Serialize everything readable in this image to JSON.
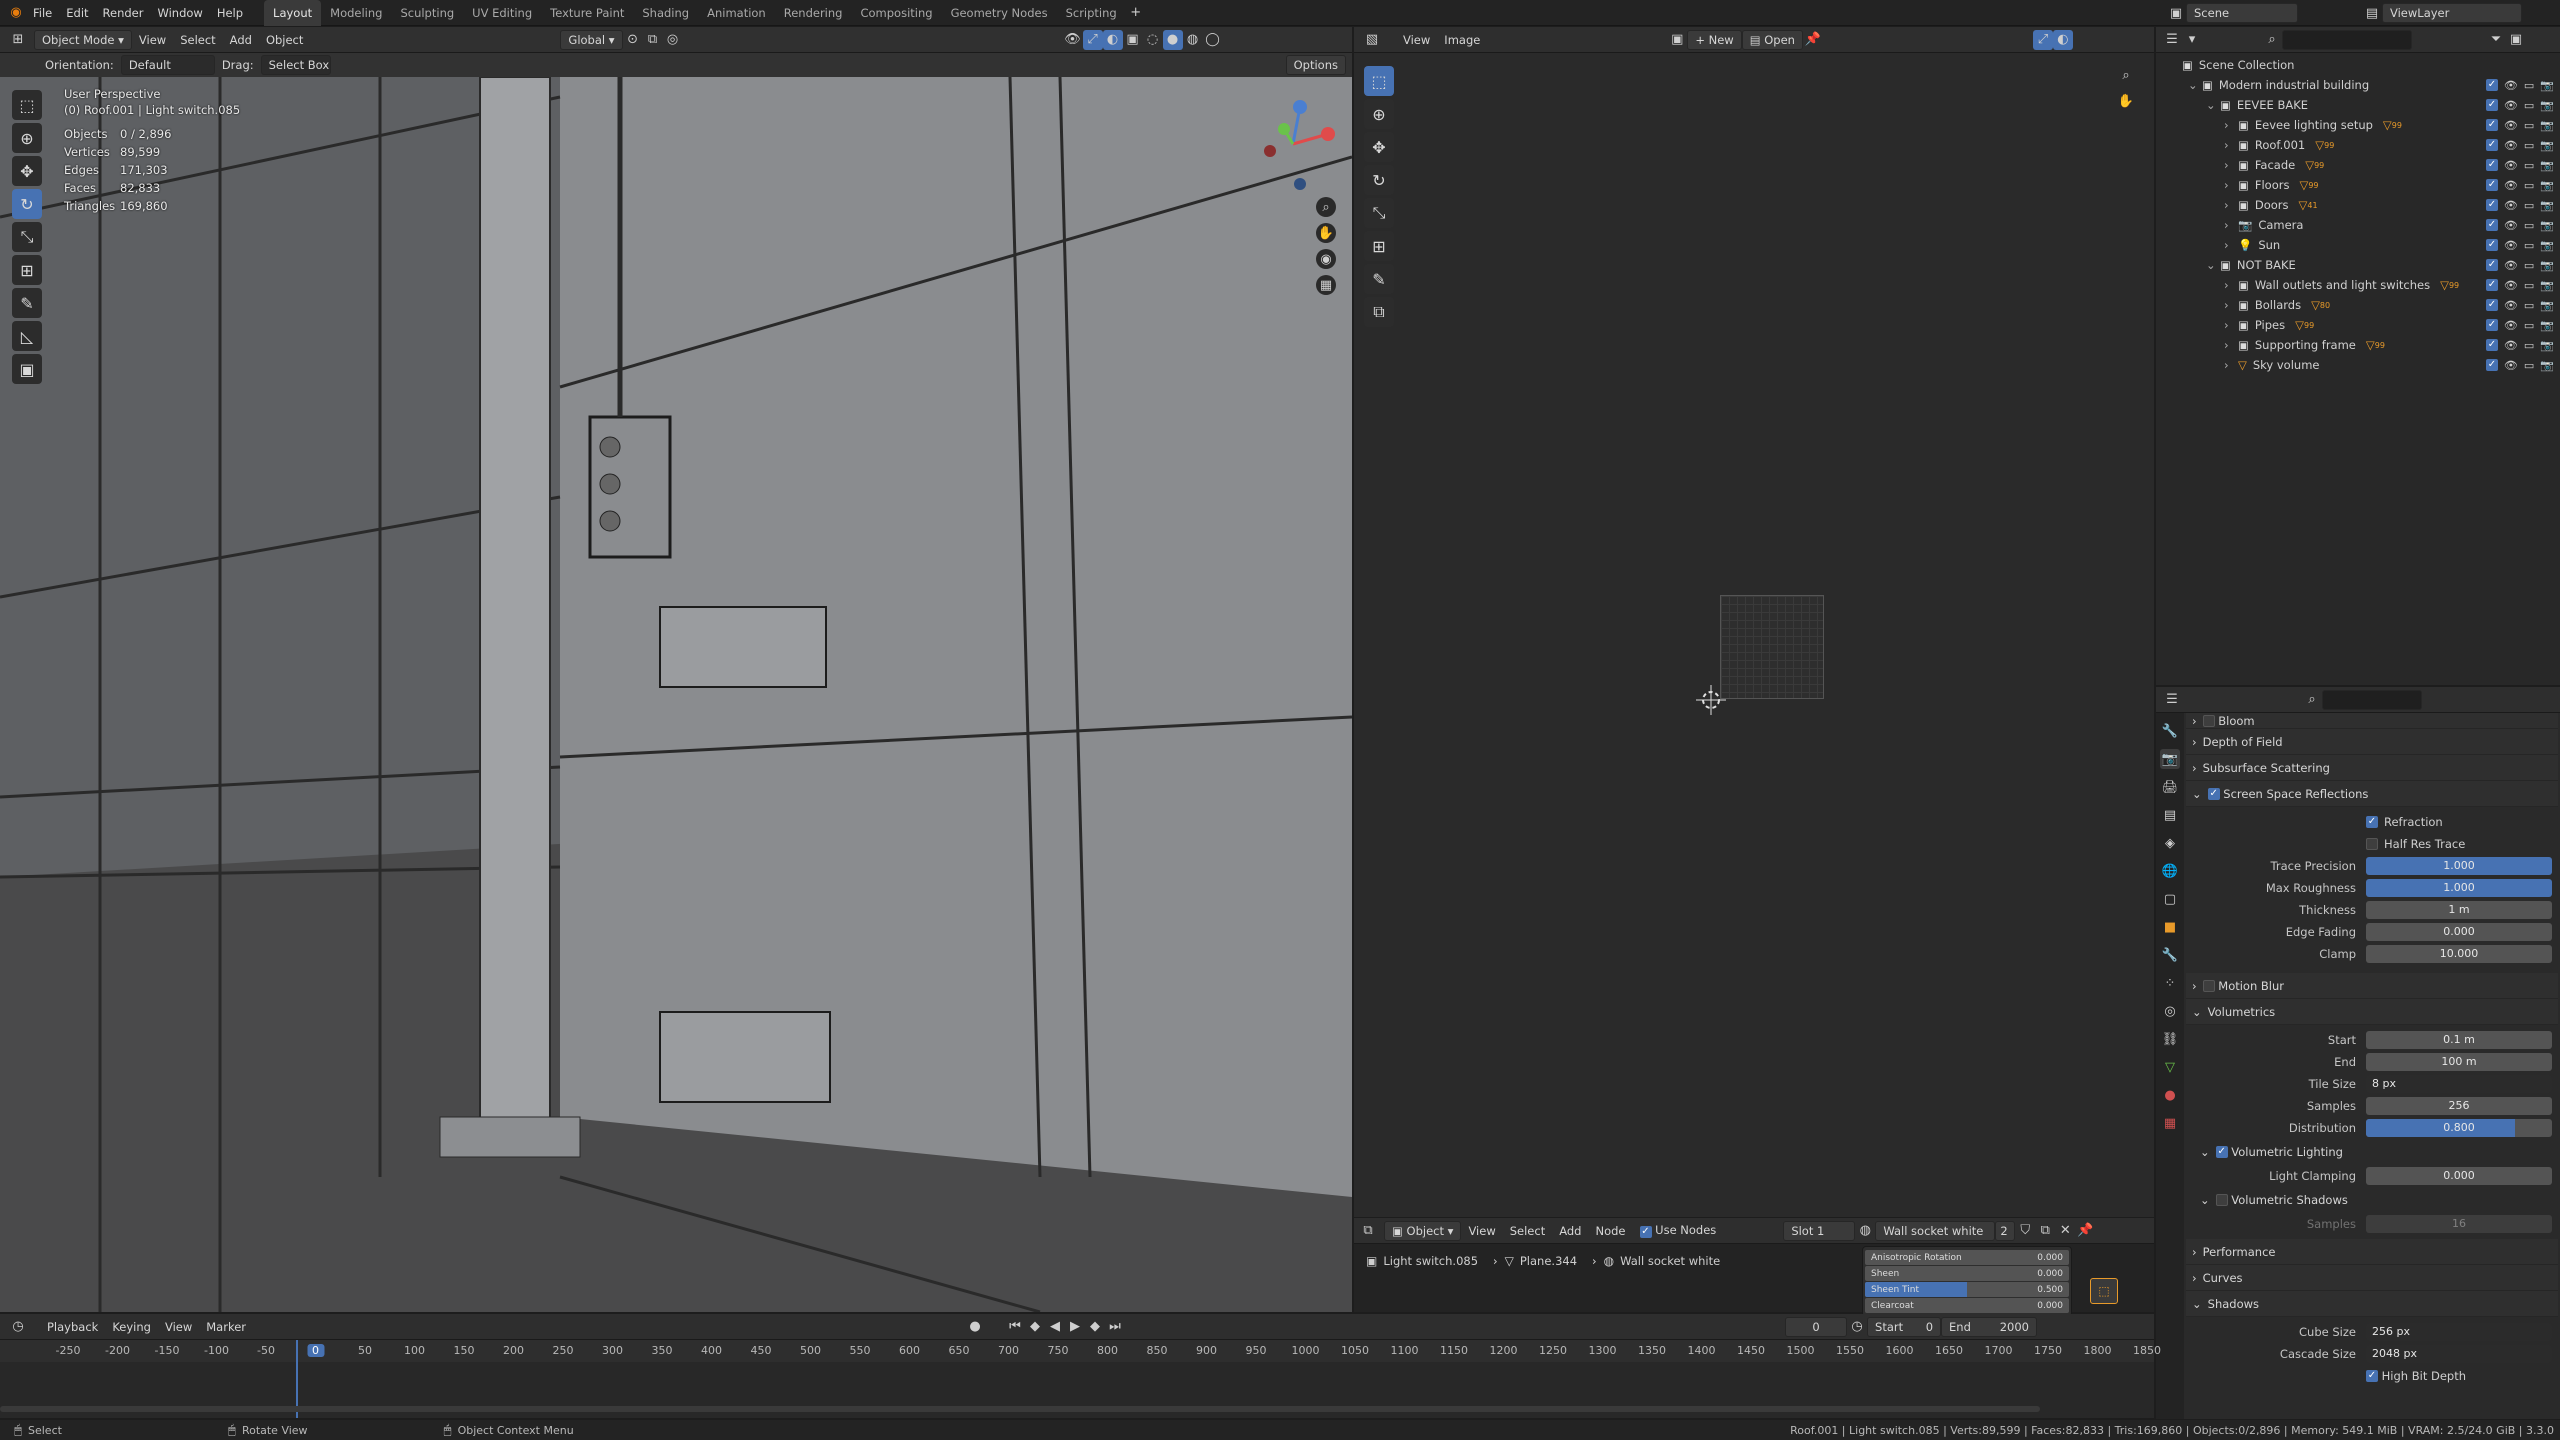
{
  "topbar": {
    "menus": [
      "File",
      "Edit",
      "Render",
      "Window",
      "Help"
    ],
    "workspaces": [
      "Layout",
      "Modeling",
      "Sculpting",
      "UV Editing",
      "Texture Paint",
      "Shading",
      "Animation",
      "Rendering",
      "Compositing",
      "Geometry Nodes",
      "Scripting"
    ],
    "active_workspace": "Layout",
    "scene_label": "Scene",
    "viewlayer_label": "ViewLayer"
  },
  "viewport": {
    "mode": "Object Mode",
    "menus": [
      "View",
      "Select",
      "Add",
      "Object"
    ],
    "transform": "Global",
    "orientation_label": "Orientation:",
    "orientation_value": "Default",
    "drag_label": "Drag:",
    "drag_value": "Select Box",
    "options_label": "Options",
    "perspective": "User Perspective",
    "active_object": "(0) Roof.001 | Light switch.085",
    "stats": [
      {
        "k": "Objects",
        "v": "0 / 2,896"
      },
      {
        "k": "Vertices",
        "v": "89,599"
      },
      {
        "k": "Edges",
        "v": "171,303"
      },
      {
        "k": "Faces",
        "v": "82,833"
      },
      {
        "k": "Triangles",
        "v": "169,860"
      }
    ]
  },
  "image_editor": {
    "menus": [
      "View",
      "Image"
    ],
    "new_label": "New",
    "open_label": "Open"
  },
  "node_editor": {
    "object_label": "Object",
    "menus": [
      "View",
      "Select",
      "Add",
      "Node"
    ],
    "use_nodes": "Use Nodes",
    "slot": "Slot 1",
    "material": "Wall socket white",
    "users": "2",
    "breadcrumb": [
      "Light switch.085",
      "Plane.344",
      "Wall socket white"
    ],
    "sliders": [
      {
        "label": "Anisotropic Rotation",
        "value": "0.000",
        "fill": 0
      },
      {
        "label": "Sheen",
        "value": "0.000",
        "fill": 0
      },
      {
        "label": "Sheen Tint",
        "value": "0.500",
        "fill": 0.5
      },
      {
        "label": "Clearcoat",
        "value": "0.000",
        "fill": 0
      }
    ]
  },
  "outliner": {
    "root": "Scene Collection",
    "items": [
      {
        "name": "Modern industrial building",
        "depth": 1,
        "icon": "collection"
      },
      {
        "name": "EEVEE BAKE",
        "depth": 2,
        "icon": "collection"
      },
      {
        "name": "Eevee lighting setup",
        "depth": 3,
        "icon": "collection",
        "badge": "99"
      },
      {
        "name": "Roof.001",
        "depth": 3,
        "icon": "collection",
        "badge": "99"
      },
      {
        "name": "Facade",
        "depth": 3,
        "icon": "collection",
        "badge": "99"
      },
      {
        "name": "Floors",
        "depth": 3,
        "icon": "collection",
        "badge": "99"
      },
      {
        "name": "Doors",
        "depth": 3,
        "icon": "collection",
        "badge": "41"
      },
      {
        "name": "Camera",
        "depth": 3,
        "icon": "camera"
      },
      {
        "name": "Sun",
        "depth": 3,
        "icon": "light"
      },
      {
        "name": "NOT BAKE",
        "depth": 2,
        "icon": "collection"
      },
      {
        "name": "Wall outlets and light switches",
        "depth": 3,
        "icon": "collection",
        "badge": "99"
      },
      {
        "name": "Bollards",
        "depth": 3,
        "icon": "collection",
        "badge": "80"
      },
      {
        "name": "Pipes",
        "depth": 3,
        "icon": "collection",
        "badge": "99"
      },
      {
        "name": "Supporting frame",
        "depth": 3,
        "icon": "collection",
        "badge": "99"
      },
      {
        "name": "Sky volume",
        "depth": 3,
        "icon": "mesh"
      }
    ]
  },
  "properties": {
    "sections": {
      "bloom": "Bloom",
      "dof": "Depth of Field",
      "sss": "Subsurface Scattering",
      "ssr": "Screen Space Reflections",
      "motion_blur": "Motion Blur",
      "volumetrics": "Volumetrics",
      "performance": "Performance",
      "curves": "Curves",
      "shadows": "Shadows"
    },
    "ssr_checks": [
      {
        "label": "Refraction",
        "on": true
      },
      {
        "label": "Half Res Trace",
        "on": false
      }
    ],
    "ssr_fields": [
      {
        "label": "Trace Precision",
        "value": "1.000",
        "blue": true
      },
      {
        "label": "Max Roughness",
        "value": "1.000",
        "blue": true
      },
      {
        "label": "Thickness",
        "value": "1 m",
        "blue": false
      },
      {
        "label": "Edge Fading",
        "value": "0.000",
        "blue": false
      },
      {
        "label": "Clamp",
        "value": "10.000",
        "blue": false
      }
    ],
    "vol_fields": [
      {
        "label": "Start",
        "value": "0.1 m"
      },
      {
        "label": "End",
        "value": "100 m"
      },
      {
        "label": "Tile Size",
        "value": "8 px"
      },
      {
        "label": "Samples",
        "value": "256"
      },
      {
        "label": "Distribution",
        "value": "0.800",
        "fill": 0.8
      }
    ],
    "vol_lighting": "Volumetric Lighting",
    "light_clamping_label": "Light Clamping",
    "light_clamping": "0.000",
    "vol_shadows": "Volumetric Shadows",
    "vol_shadow_samples_label": "Samples",
    "vol_shadow_samples": "16",
    "cube_size_label": "Cube Size",
    "cube_size": "256 px",
    "cascade_size_label": "Cascade Size",
    "cascade_size": "2048 px",
    "high_bit_depth": "High Bit Depth"
  },
  "timeline": {
    "menus": [
      "Playback",
      "Keying",
      "View",
      "Marker"
    ],
    "current_frame": "0",
    "start_label": "Start",
    "start": "0",
    "end_label": "End",
    "end": "2000",
    "ticks": [
      "-250",
      "-200",
      "-150",
      "-100",
      "-50",
      "0",
      "50",
      "100",
      "150",
      "200",
      "250",
      "300",
      "350",
      "400",
      "450",
      "500",
      "550",
      "600",
      "650",
      "700",
      "750",
      "800",
      "850",
      "900",
      "950",
      "1000",
      "1050",
      "1100",
      "1150",
      "1200",
      "1250",
      "1300",
      "1350",
      "1400",
      "1450",
      "1500",
      "1550",
      "1600",
      "1650",
      "1700",
      "1750",
      "1800",
      "1850"
    ]
  },
  "statusbar": {
    "select": "Select",
    "rotate": "Rotate View",
    "context": "Object Context Menu",
    "info": "Roof.001 | Light switch.085 | Verts:89,599 | Faces:82,833 | Tris:169,860 | Objects:0/2,896 | Memory: 549.1 MiB | VRAM: 2.5/24.0 GiB | 3.3.0"
  }
}
